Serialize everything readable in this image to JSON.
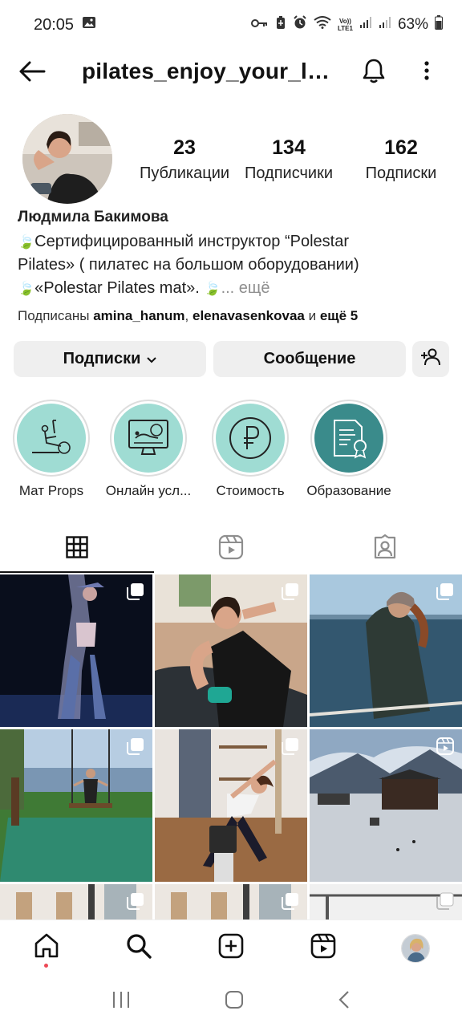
{
  "status_bar": {
    "time": "20:05",
    "lte_top": "Vo))",
    "lte_bottom": "LTE1",
    "battery": "63%"
  },
  "header": {
    "username": "pilates_enjoy_your_li...",
    "icons": [
      "back-arrow-icon",
      "bell-icon",
      "more-vertical-icon"
    ]
  },
  "profile": {
    "stats": [
      {
        "value": "23",
        "label": "Публикации"
      },
      {
        "value": "134",
        "label": "Подписчики"
      },
      {
        "value": "162",
        "label": "Подписки"
      }
    ],
    "full_name": "Людмила Бакимова",
    "bio_line1": "Сертифицированный инструктор “Polestar",
    "bio_line2": "Pilates» ( пилатес на большом оборудовании)",
    "bio_line3": "«Polestar Pilates mat».",
    "bio_more": "... ещё",
    "followed_prefix": "Подписаны ",
    "followed_user1": "amina_hanum",
    "followed_sep": ", ",
    "followed_user2": "elenavasenkovaa",
    "followed_and": " и ",
    "followed_more": "ещё 5"
  },
  "actions": {
    "following_label": "Подписки",
    "message_label": "Сообщение"
  },
  "highlights": [
    {
      "label": "Мат Props",
      "icon": "pilates-mat-icon"
    },
    {
      "label": "Онлайн усл...",
      "icon": "online-monitor-icon"
    },
    {
      "label": "Стоимость",
      "icon": "ruble-icon"
    },
    {
      "label": "Образование",
      "icon": "certificate-icon"
    }
  ],
  "tabs": [
    "grid-icon",
    "reels-icon",
    "tagged-icon"
  ],
  "posts": [
    {
      "type": "carousel"
    },
    {
      "type": "carousel"
    },
    {
      "type": "carousel"
    },
    {
      "type": "carousel"
    },
    {
      "type": "carousel"
    },
    {
      "type": "reel"
    },
    {
      "type": "carousel"
    },
    {
      "type": "carousel"
    },
    {
      "type": "carousel"
    }
  ],
  "colors": {
    "highlight_teal": "#9fdcd3",
    "highlight_dark_teal": "#3a8b8b",
    "button_grey": "#efefef",
    "notification_dot": "#ed4956",
    "leaf_green": "#5f9c2a"
  }
}
